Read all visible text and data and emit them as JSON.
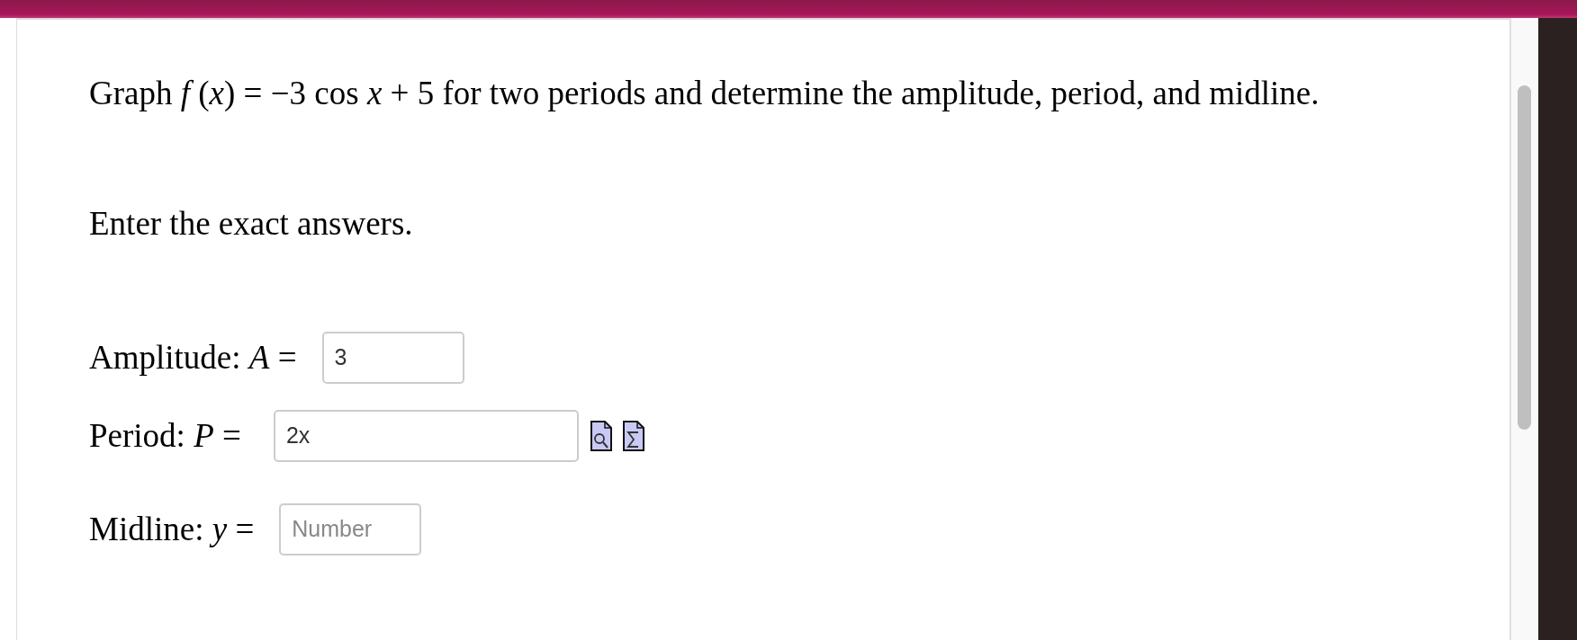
{
  "question": "Graph *f* (*x*) = −3 cos *x* + 5 for two periods and determine the amplitude, period, and midline.",
  "instruction": "Enter the exact answers.",
  "answers": [
    {
      "kind": "number",
      "label": "Amplitude: *A* =",
      "value": "3"
    },
    {
      "kind": "expression",
      "label": "Period: *P* =",
      "value": "2x"
    },
    {
      "kind": "number",
      "label": "Midline: *y* =",
      "placeholder": "Number"
    }
  ]
}
